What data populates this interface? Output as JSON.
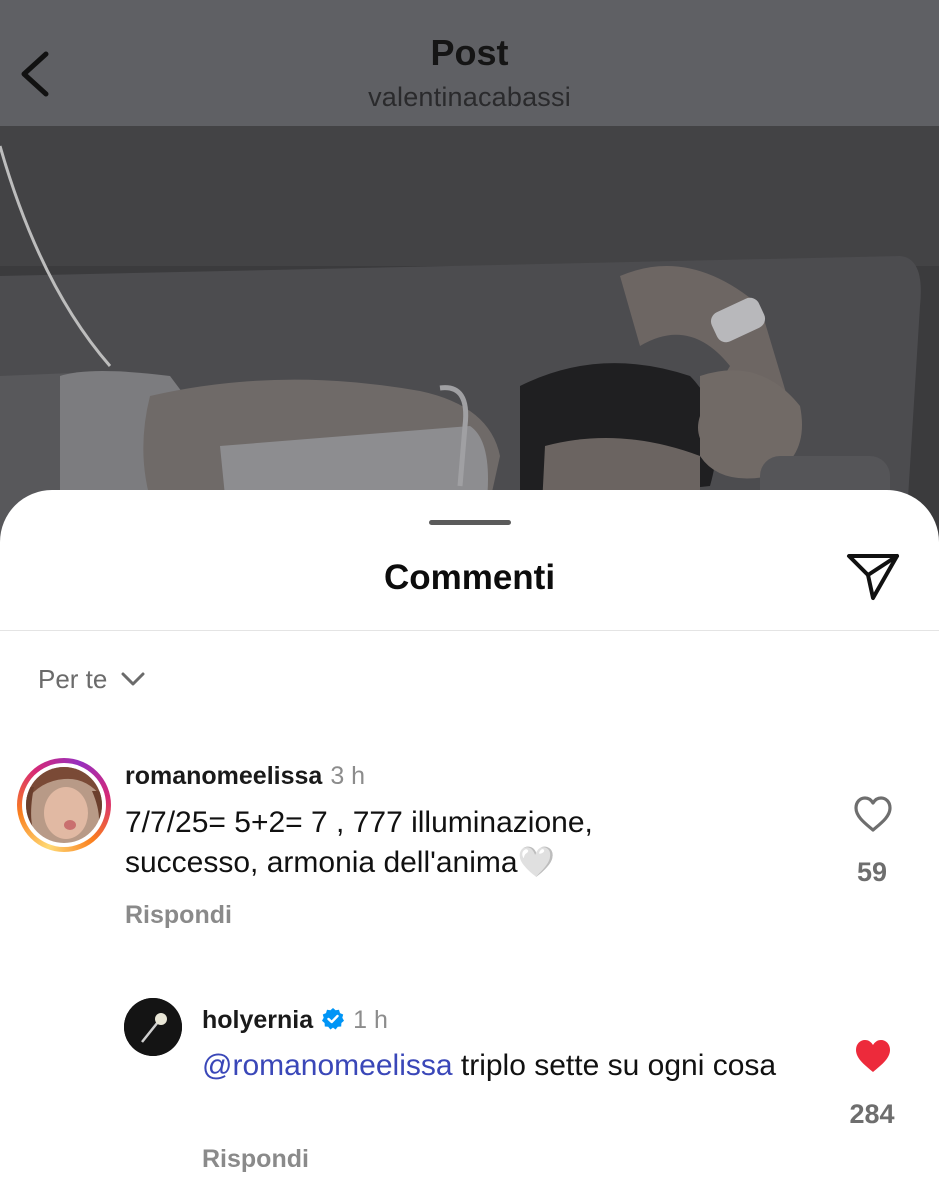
{
  "header": {
    "title": "Post",
    "username": "valentinacabassi",
    "back_icon": "chevron-left-icon"
  },
  "sheet": {
    "title": "Commenti",
    "share_icon": "send-icon",
    "sort_label": "Per te",
    "sort_icon": "chevron-down-icon"
  },
  "comments": [
    {
      "username": "romanomeelissa",
      "time": "3 h",
      "text": "7/7/25= 5+2= 7 , 777 illuminazione, successo, armonia dell'anima🤍",
      "reply_label": "Rispondi",
      "likes": "59",
      "liked": false
    },
    {
      "username": "holyernia",
      "verified": true,
      "time": "1 h",
      "mention": "@romanomeelissa",
      "text": " triplo sette su ogni cosa",
      "reply_label": "Rispondi",
      "likes": "284",
      "liked": true
    }
  ],
  "colors": {
    "header_bg": "#5f6064",
    "mention": "#3a47b8",
    "like_red": "#ed2a3b",
    "verified_blue": "#0095f6"
  }
}
